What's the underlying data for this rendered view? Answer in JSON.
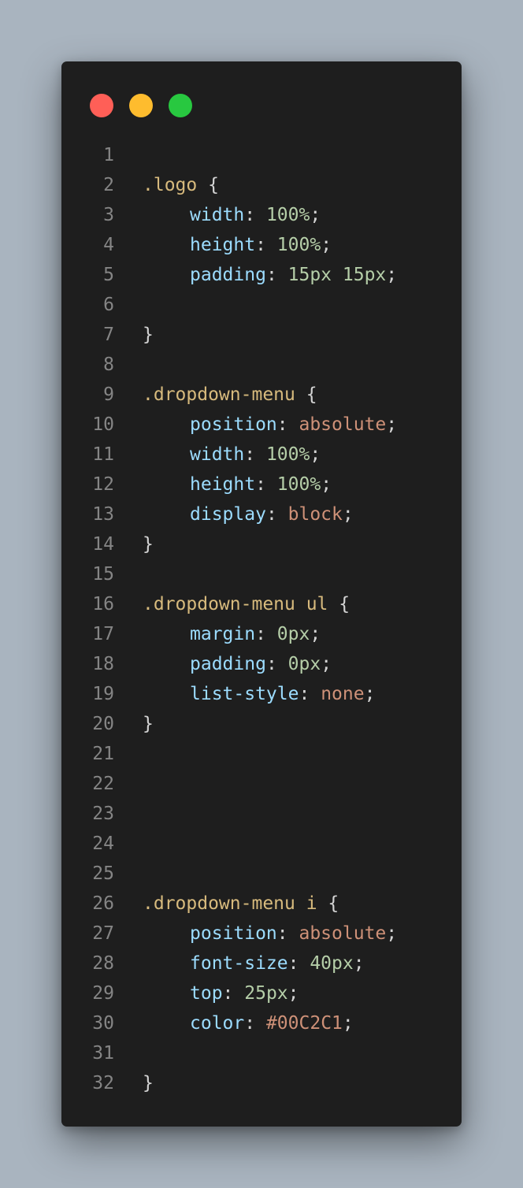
{
  "window": {
    "controls": [
      {
        "name": "close",
        "color": "#ff5f57"
      },
      {
        "name": "minimize",
        "color": "#febc2e"
      },
      {
        "name": "maximize",
        "color": "#28c840"
      }
    ]
  },
  "colors": {
    "selector": "#d7ba7d",
    "property": "#9cdcfe",
    "number": "#b5cea8",
    "keyword": "#ce9178",
    "punct": "#d4d4d4",
    "line_number": "#858585",
    "background": "#1e1e1e",
    "page_background": "#a9b4bf"
  },
  "code": {
    "lines": [
      {
        "n": "1",
        "tokens": []
      },
      {
        "n": "2",
        "tokens": [
          {
            "t": ".logo",
            "c": "selector"
          },
          {
            "t": " {",
            "c": "punct"
          }
        ]
      },
      {
        "n": "3",
        "indent": true,
        "tokens": [
          {
            "t": "width",
            "c": "property"
          },
          {
            "t": ": ",
            "c": "punct"
          },
          {
            "t": "100%",
            "c": "number"
          },
          {
            "t": ";",
            "c": "punct"
          }
        ]
      },
      {
        "n": "4",
        "indent": true,
        "tokens": [
          {
            "t": "height",
            "c": "property"
          },
          {
            "t": ": ",
            "c": "punct"
          },
          {
            "t": "100%",
            "c": "number"
          },
          {
            "t": ";",
            "c": "punct"
          }
        ]
      },
      {
        "n": "5",
        "indent": true,
        "tokens": [
          {
            "t": "padding",
            "c": "property"
          },
          {
            "t": ": ",
            "c": "punct"
          },
          {
            "t": "15px 15px",
            "c": "number"
          },
          {
            "t": ";",
            "c": "punct"
          }
        ]
      },
      {
        "n": "6",
        "tokens": []
      },
      {
        "n": "7",
        "tokens": [
          {
            "t": "}",
            "c": "punct"
          }
        ]
      },
      {
        "n": "8",
        "tokens": []
      },
      {
        "n": "9",
        "tokens": [
          {
            "t": ".dropdown-menu",
            "c": "selector"
          },
          {
            "t": " {",
            "c": "punct"
          }
        ]
      },
      {
        "n": "10",
        "indent": true,
        "tokens": [
          {
            "t": "position",
            "c": "property"
          },
          {
            "t": ": ",
            "c": "punct"
          },
          {
            "t": "absolute",
            "c": "keyword"
          },
          {
            "t": ";",
            "c": "punct"
          }
        ]
      },
      {
        "n": "11",
        "indent": true,
        "tokens": [
          {
            "t": "width",
            "c": "property"
          },
          {
            "t": ": ",
            "c": "punct"
          },
          {
            "t": "100%",
            "c": "number"
          },
          {
            "t": ";",
            "c": "punct"
          }
        ]
      },
      {
        "n": "12",
        "indent": true,
        "tokens": [
          {
            "t": "height",
            "c": "property"
          },
          {
            "t": ": ",
            "c": "punct"
          },
          {
            "t": "100%",
            "c": "number"
          },
          {
            "t": ";",
            "c": "punct"
          }
        ]
      },
      {
        "n": "13",
        "indent": true,
        "tokens": [
          {
            "t": "display",
            "c": "property"
          },
          {
            "t": ": ",
            "c": "punct"
          },
          {
            "t": "block",
            "c": "keyword"
          },
          {
            "t": ";",
            "c": "punct"
          }
        ]
      },
      {
        "n": "14",
        "tokens": [
          {
            "t": "}",
            "c": "punct"
          }
        ]
      },
      {
        "n": "15",
        "tokens": []
      },
      {
        "n": "16",
        "tokens": [
          {
            "t": ".dropdown-menu ul",
            "c": "selector"
          },
          {
            "t": " {",
            "c": "punct"
          }
        ]
      },
      {
        "n": "17",
        "indent": true,
        "tokens": [
          {
            "t": "margin",
            "c": "property"
          },
          {
            "t": ": ",
            "c": "punct"
          },
          {
            "t": "0px",
            "c": "number"
          },
          {
            "t": ";",
            "c": "punct"
          }
        ]
      },
      {
        "n": "18",
        "indent": true,
        "tokens": [
          {
            "t": "padding",
            "c": "property"
          },
          {
            "t": ": ",
            "c": "punct"
          },
          {
            "t": "0px",
            "c": "number"
          },
          {
            "t": ";",
            "c": "punct"
          }
        ]
      },
      {
        "n": "19",
        "indent": true,
        "tokens": [
          {
            "t": "list-style",
            "c": "property"
          },
          {
            "t": ": ",
            "c": "punct"
          },
          {
            "t": "none",
            "c": "keyword"
          },
          {
            "t": ";",
            "c": "punct"
          }
        ]
      },
      {
        "n": "20",
        "tokens": [
          {
            "t": "}",
            "c": "punct"
          }
        ]
      },
      {
        "n": "21",
        "tokens": []
      },
      {
        "n": "22",
        "tokens": []
      },
      {
        "n": "23",
        "tokens": []
      },
      {
        "n": "24",
        "tokens": []
      },
      {
        "n": "25",
        "tokens": []
      },
      {
        "n": "26",
        "tokens": [
          {
            "t": ".dropdown-menu i",
            "c": "selector"
          },
          {
            "t": " {",
            "c": "punct"
          }
        ]
      },
      {
        "n": "27",
        "indent": true,
        "tokens": [
          {
            "t": "position",
            "c": "property"
          },
          {
            "t": ": ",
            "c": "punct"
          },
          {
            "t": "absolute",
            "c": "keyword"
          },
          {
            "t": ";",
            "c": "punct"
          }
        ]
      },
      {
        "n": "28",
        "indent": true,
        "tokens": [
          {
            "t": "font-size",
            "c": "property"
          },
          {
            "t": ": ",
            "c": "punct"
          },
          {
            "t": "40px",
            "c": "number"
          },
          {
            "t": ";",
            "c": "punct"
          }
        ]
      },
      {
        "n": "29",
        "indent": true,
        "tokens": [
          {
            "t": "top",
            "c": "property"
          },
          {
            "t": ": ",
            "c": "punct"
          },
          {
            "t": "25px",
            "c": "number"
          },
          {
            "t": ";",
            "c": "punct"
          }
        ]
      },
      {
        "n": "30",
        "indent": true,
        "tokens": [
          {
            "t": "color",
            "c": "property"
          },
          {
            "t": ": ",
            "c": "punct"
          },
          {
            "t": "#00C2C1",
            "c": "keyword"
          },
          {
            "t": ";",
            "c": "punct"
          }
        ]
      },
      {
        "n": "31",
        "tokens": []
      },
      {
        "n": "32",
        "tokens": [
          {
            "t": "}",
            "c": "punct"
          }
        ]
      }
    ]
  }
}
